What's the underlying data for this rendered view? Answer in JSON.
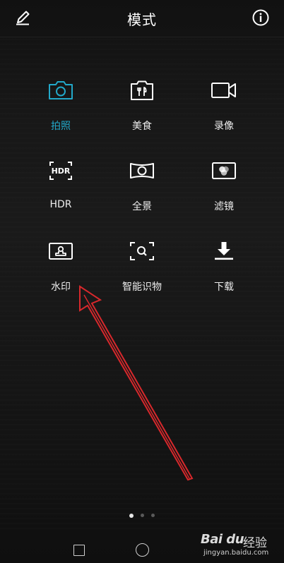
{
  "header": {
    "title": "模式",
    "edit_icon": "pencil-icon",
    "info_icon": "info-icon"
  },
  "modes": [
    {
      "id": "photo",
      "label": "拍照",
      "icon": "camera-icon",
      "active": true
    },
    {
      "id": "food",
      "label": "美食",
      "icon": "food-icon",
      "active": false
    },
    {
      "id": "video",
      "label": "录像",
      "icon": "video-icon",
      "active": false
    },
    {
      "id": "hdr",
      "label": "HDR",
      "icon": "hdr-icon",
      "icon_text": "HDR",
      "active": false
    },
    {
      "id": "panorama",
      "label": "全景",
      "icon": "panorama-icon",
      "active": false
    },
    {
      "id": "filter",
      "label": "滤镜",
      "icon": "filter-icon",
      "active": false
    },
    {
      "id": "watermark",
      "label": "水印",
      "icon": "watermark-icon",
      "active": false
    },
    {
      "id": "smart-recognize",
      "label": "智能识物",
      "icon": "scan-search-icon",
      "active": false
    },
    {
      "id": "download",
      "label": "下载",
      "icon": "download-icon",
      "active": false
    }
  ],
  "pagination": {
    "pages": 3,
    "current": 1
  },
  "navbar": {
    "recent_icon": "square-icon",
    "home_icon": "circle-icon"
  },
  "overlay": {
    "watermark_logo": "Bai du",
    "watermark_cn": "经验",
    "watermark_url": "jingyan.baidu.com"
  },
  "colors": {
    "accent": "#22a8c9",
    "arrow": "#d8282c",
    "background": "#141414"
  }
}
